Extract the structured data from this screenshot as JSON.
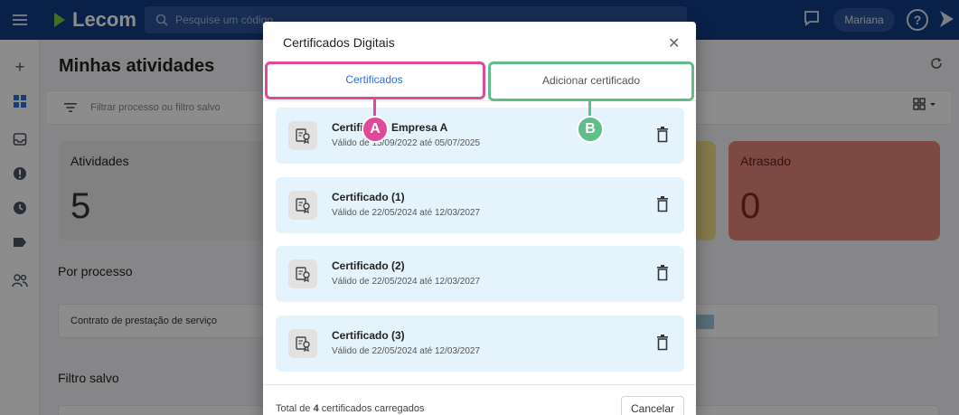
{
  "app": {
    "brand": "Lecom",
    "search_placeholder": "Pesquise um código",
    "user_name": "Mariana",
    "help_label": "?"
  },
  "main": {
    "title": "Minhas atividades",
    "filter_placeholder": "Filtrar processo ou filtro salvo",
    "cards": [
      {
        "label": "Atividades",
        "value": "5"
      },
      {
        "label": "Atrasado",
        "value": "0"
      }
    ],
    "by_process_title": "Por processo",
    "process_row": "Contrato de prestação de serviço",
    "saved_filter_title": "Filtro salvo"
  },
  "modal": {
    "title": "Certificados Digitais",
    "tabs": [
      {
        "label": "Certificados",
        "active": true
      },
      {
        "label": "Adicionar certificado",
        "active": false
      }
    ],
    "certificates": [
      {
        "name": "Certificado Empresa A",
        "validity": "Válido de 15/09/2022 até 05/07/2025"
      },
      {
        "name": "Certificado (1)",
        "validity": "Válido de 22/05/2024 até 12/03/2027"
      },
      {
        "name": "Certificado (2)",
        "validity": "Válido de 22/05/2024 até 12/03/2027"
      },
      {
        "name": "Certificado (3)",
        "validity": "Válido de 22/05/2024 até 12/03/2027"
      }
    ],
    "footer_prefix": "Total de",
    "footer_count": "4",
    "footer_suffix": "certificados carregados",
    "cancel_label": "Cancelar"
  },
  "annotations": {
    "a": "A",
    "b": "B"
  },
  "colors": {
    "topbar": "#123c84",
    "tab_active": "#2f6fd6",
    "highlight_a": "#e0499a",
    "highlight_b": "#61bd8a",
    "card_red": "#e7867a",
    "card_yellow": "#f2df8a",
    "cert_bg": "#e5f4fc"
  }
}
